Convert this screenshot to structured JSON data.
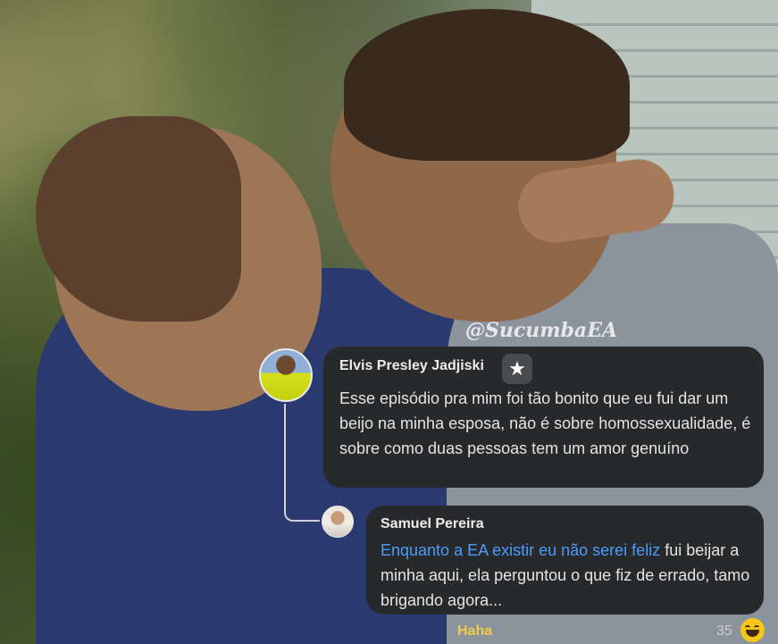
{
  "watermark": "@SucumbaEA",
  "comment": {
    "author": "Elvis Presley Jadjiski",
    "badge_icon": "star-icon",
    "text": "Esse episódio pra mim foi tão bonito que eu fui dar um beijo na minha esposa, não é sobre homossexualidade, é sobre como duas pessoas tem um amor genuíno"
  },
  "reply": {
    "author": "Samuel Pereira",
    "mention": "Enquanto a EA existir eu não serei feliz",
    "text": " fui beijar a minha aqui, ela perguntou o que fiz de errado, tamo brigando agora..."
  },
  "reactions": {
    "label": "Haha",
    "count": "35",
    "icon": "laughing-emoji-icon",
    "colors": {
      "label": "#f2c94c",
      "emoji": "#f7c61a"
    }
  },
  "colors": {
    "bubble": "#28292b",
    "mention": "#4b9bff"
  }
}
